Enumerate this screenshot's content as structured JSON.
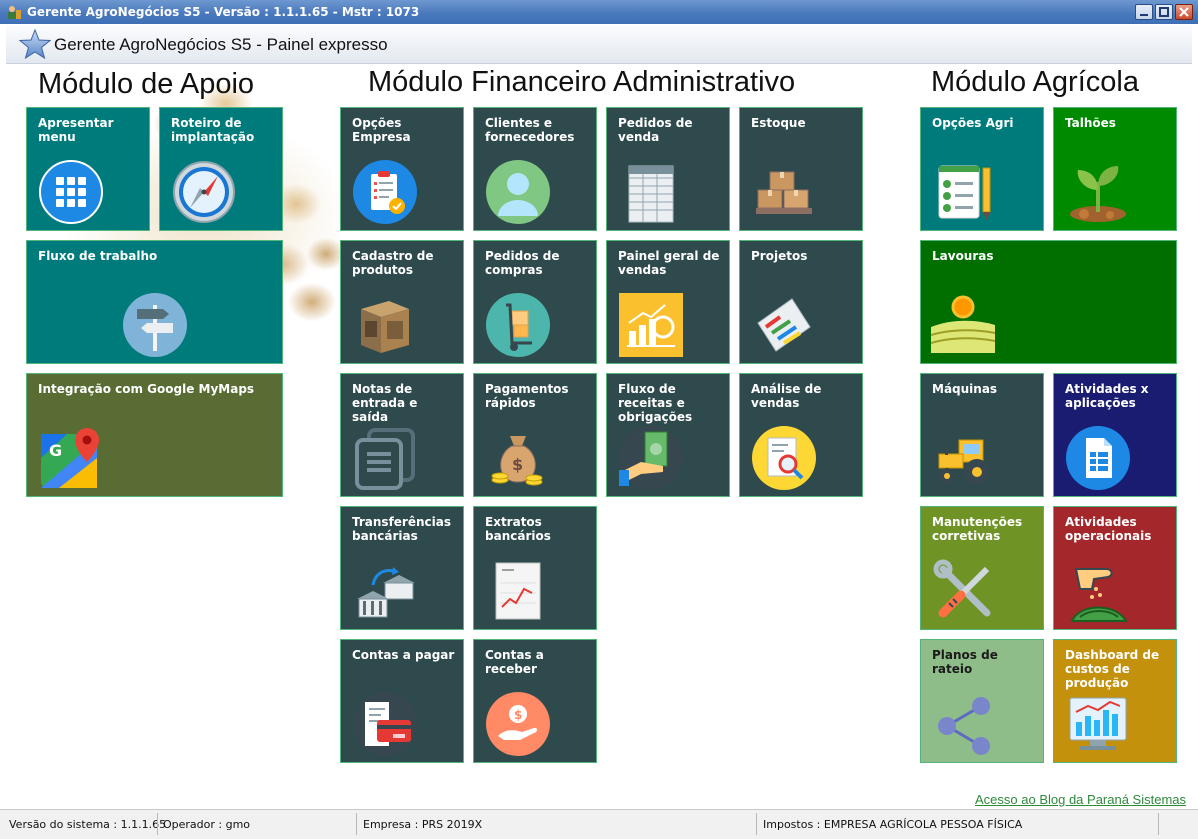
{
  "window": {
    "title": "Gerente AgroNegócios S5 -  Versão : 1.1.1.65 - Mstr : 1073",
    "icon": "farmer-app-icon"
  },
  "header": {
    "title": "Gerente AgroNegócios S5 - Painel expresso",
    "icon": "star-icon"
  },
  "colors": {
    "teal": "#007b7c",
    "dark_slate": "#2f4a4c",
    "olive": "#586c33",
    "green": "#008a00",
    "dark_green": "#006f00",
    "navy": "#1a1c72",
    "olive_green": "#6f9324",
    "crimson": "#a4272b",
    "sage": "#8fbd8a",
    "gold": "#c3910c"
  },
  "modules": {
    "apoio": {
      "title": "Módulo de Apoio",
      "tiles": [
        {
          "label": "Apresentar menu",
          "icon": "grid-icon"
        },
        {
          "label": "Roteiro de implantação",
          "icon": "compass-icon"
        },
        {
          "label": "Fluxo de trabalho",
          "icon": "signpost-icon"
        },
        {
          "label": "Integração com Google MyMaps",
          "icon": "google-maps-icon"
        }
      ]
    },
    "financeiro": {
      "title": "Módulo Financeiro Administrativo",
      "tiles": [
        {
          "label": "Opções Empresa",
          "icon": "checklist-icon"
        },
        {
          "label": "Clientes e fornecedores",
          "icon": "person-icon"
        },
        {
          "label": "Pedidos de venda",
          "icon": "spreadsheet-icon"
        },
        {
          "label": "Estoque",
          "icon": "boxes-icon"
        },
        {
          "label": "Cadastro de produtos",
          "icon": "crate-icon"
        },
        {
          "label": "Pedidos de compras",
          "icon": "hand-truck-icon"
        },
        {
          "label": "Painel geral de vendas",
          "icon": "sales-chart-icon"
        },
        {
          "label": "Projetos",
          "icon": "gantt-icon"
        },
        {
          "label": "Notas de entrada e saída",
          "icon": "documents-icon"
        },
        {
          "label": "Pagamentos rápidos",
          "icon": "money-bag-icon"
        },
        {
          "label": "Fluxo de receitas e obrigações",
          "icon": "cash-hand-icon"
        },
        {
          "label": "Análise de vendas",
          "icon": "report-search-icon"
        },
        {
          "label": "Transferências bancárias",
          "icon": "bank-transfer-icon"
        },
        {
          "label": "Extratos bancários",
          "icon": "statement-chart-icon"
        },
        {
          "label": "Contas a pagar",
          "icon": "receipt-card-icon"
        },
        {
          "label": "Contas a receber",
          "icon": "coin-hand-icon"
        }
      ]
    },
    "agricola": {
      "title": "Módulo Agrícola",
      "tiles": [
        {
          "label": "Opções Agri",
          "icon": "clipboard-pencil-icon"
        },
        {
          "label": "Talhões",
          "icon": "sprout-icon"
        },
        {
          "label": "Lavouras",
          "icon": "field-sun-icon"
        },
        {
          "label": "Máquinas",
          "icon": "tractor-icon"
        },
        {
          "label": "Atividades x aplicações",
          "icon": "document-table-icon"
        },
        {
          "label": "Manutenções corretivas",
          "icon": "tools-icon"
        },
        {
          "label": "Atividades operacionais",
          "icon": "sowing-hand-icon"
        },
        {
          "label": "Planos de rateio",
          "icon": "share-icon"
        },
        {
          "label": "Dashboard de custos de produção",
          "icon": "dashboard-monitor-icon"
        }
      ]
    }
  },
  "blog_link": "Acesso ao Blog da Paraná Sistemas",
  "statusbar": {
    "version": "Versão do sistema : 1.1.1.65",
    "operator": "Operador : gmo",
    "company": "Empresa : PRS 2019X",
    "taxes": "Impostos : EMPRESA AGRÍCOLA PESSOA FÍSICA"
  }
}
